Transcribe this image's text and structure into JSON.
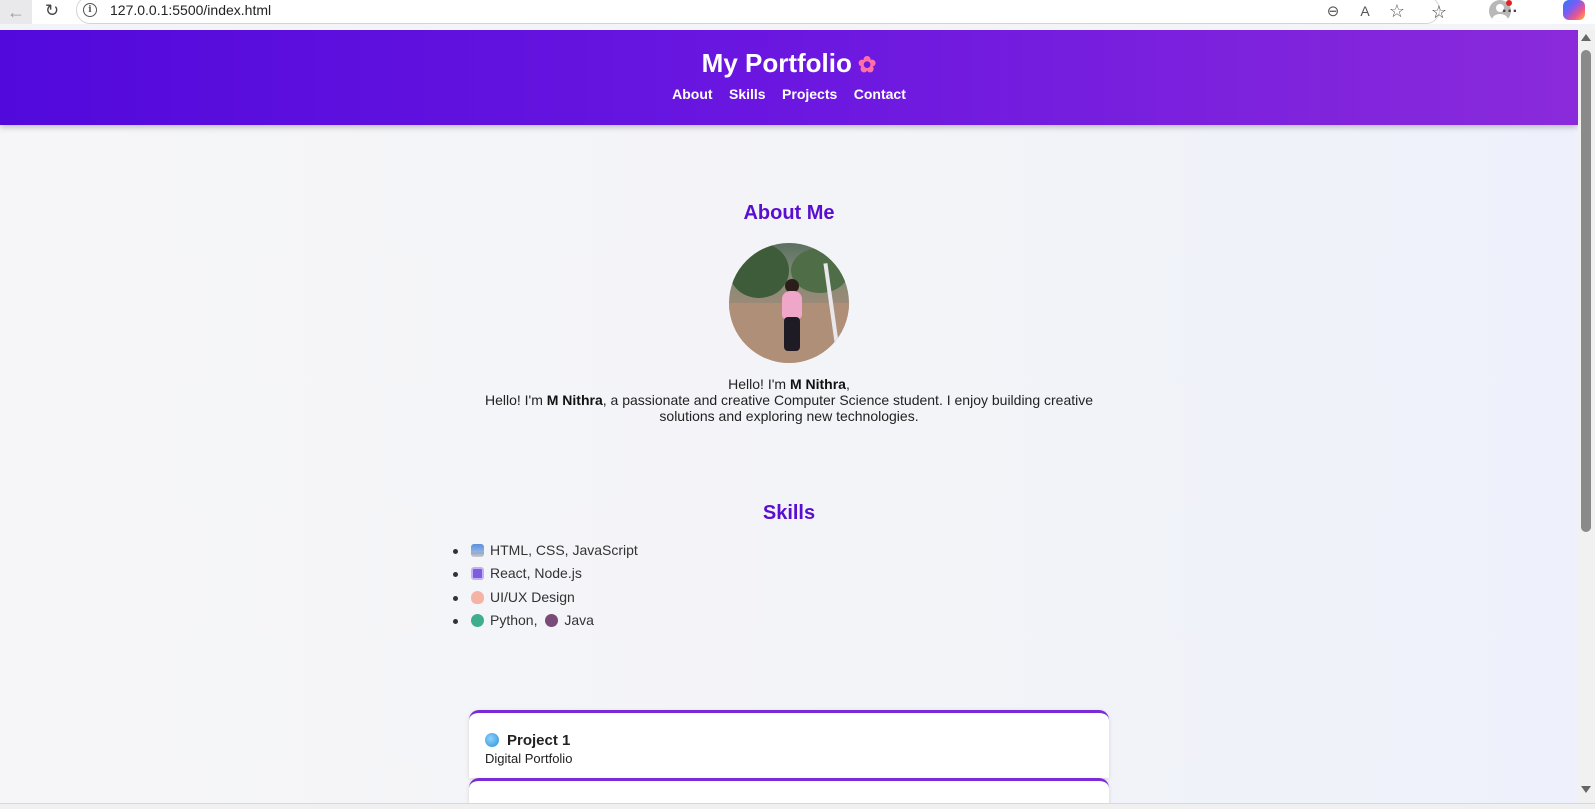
{
  "browser": {
    "url": "127.0.0.1:5500/index.html",
    "icons": [
      "back-arrow-icon",
      "refresh-icon",
      "site-info-icon",
      "zoom-out-icon",
      "read-aloud-icon",
      "favorite-star-icon",
      "favorites-icon",
      "profile-icon",
      "more-icon",
      "copilot-icon"
    ],
    "back_glyph": "←",
    "refresh_glyph": "↻",
    "info_glyph": "i",
    "zoom_glyph": "⊖",
    "read_glyph": "A",
    "star_glyph": "☆",
    "favorites_glyph": "☆",
    "more_glyph": "···"
  },
  "header": {
    "title": "My Portfolio",
    "title_emoji": "✿",
    "nav": [
      "About",
      "Skills",
      "Projects",
      "Contact"
    ]
  },
  "about": {
    "heading": "About Me",
    "greeting_prefix": "Hello! I'm ",
    "name": "M Nithra",
    "greeting_suffix": ",",
    "bio_prefix": "Hello! I'm ",
    "bio_name": "M Nithra",
    "bio_rest": ", a passionate and creative Computer Science student. I enjoy building creative solutions and exploring new technologies."
  },
  "skills": {
    "heading": "Skills",
    "items": [
      {
        "icon": "laptop-icon",
        "text": "HTML, CSS, JavaScript"
      },
      {
        "icon": "atom-icon",
        "text": "React, Node.js"
      },
      {
        "icon": "palette-icon",
        "text": "UI/UX Design"
      },
      {
        "icon": "snake-icon",
        "text": "Python, ",
        "icon2": "coffee-icon",
        "text2": "Java"
      }
    ]
  },
  "projects": [
    {
      "icon": "globe-icon",
      "title": "Project 1",
      "subtitle": "Digital Portfolio"
    }
  ],
  "colors": {
    "header_start": "#5209dc",
    "header_end": "#8a2adb",
    "heading": "#5a0fd0",
    "card_border": "#7a2ad6"
  }
}
